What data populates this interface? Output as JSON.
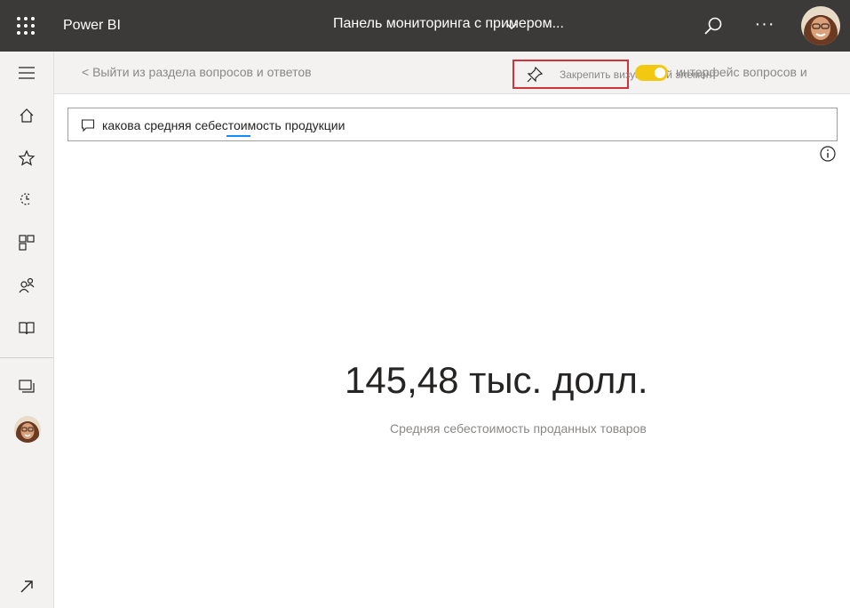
{
  "header": {
    "app_name": "Power BI",
    "dashboard_title": "Панель мониторинга с примером...",
    "more_label": "···"
  },
  "actionbar": {
    "exit_link": "< Выйти из раздела вопросов и ответов",
    "pin_label": "Закрепить визуальный элемент",
    "toggle_state": "on",
    "overflow_text": "интерфейс вопросов и"
  },
  "qa": {
    "query": "какова средняя себестоимость продукции"
  },
  "result": {
    "value": "145,48 тыс. долл.",
    "caption": "Средняя себестоимость проданных товаров"
  },
  "nav": {
    "items": [
      "home-icon",
      "favorites-icon",
      "recent-icon",
      "apps-icon",
      "shared-icon",
      "learn-icon",
      "workspaces-icon",
      "avatar",
      "expand-icon"
    ]
  },
  "colors": {
    "header_bg": "#3b3a39",
    "nav_bg": "#f3f2f1",
    "toggle": "#f2c811",
    "highlight_border": "#d13438",
    "accent": "#118dff"
  }
}
